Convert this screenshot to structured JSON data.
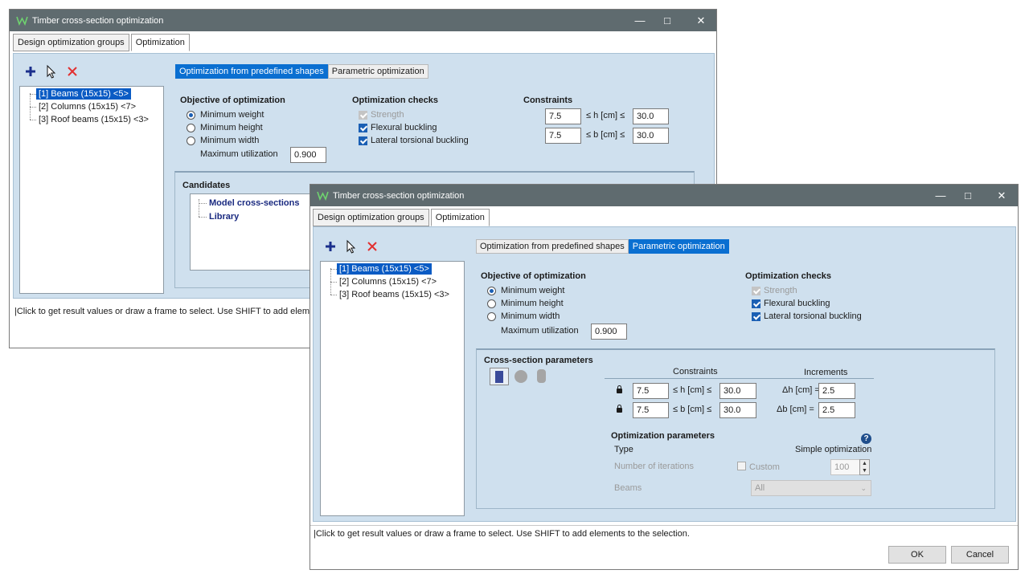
{
  "colors": {
    "titlebar": "#5f6b6f",
    "panel": "#cfe0ee",
    "accent": "#0a6fd1",
    "selection": "#0a5bc4"
  },
  "back_window": {
    "title": "Timber cross-section optimization",
    "tabs": [
      "Design optimization groups",
      "Optimization"
    ],
    "toolbar_icons": [
      "plus-icon",
      "pointer-icon",
      "close-red-icon"
    ],
    "groups": [
      "[1] Beams (15x15) <5>",
      "[2] Columns (15x15) <7>",
      "[3] Roof beams (15x15) <3>"
    ],
    "mode_buttons": {
      "predefined": "Optimization from predefined shapes",
      "parametric": "Parametric optimization"
    },
    "objective": {
      "header": "Objective of optimization",
      "options": [
        "Minimum weight",
        "Minimum height",
        "Minimum width"
      ],
      "selected": 0,
      "max_util_label": "Maximum utilization",
      "max_util_value": "0.900"
    },
    "checks": {
      "header": "Optimization checks",
      "items": [
        "Strength",
        "Flexural buckling",
        "Lateral torsional buckling"
      ]
    },
    "constraints": {
      "header": "Constraints",
      "h_min": "7.5",
      "h_label": "≤ h [cm] ≤",
      "h_max": "30.0",
      "b_min": "7.5",
      "b_label": "≤ b [cm] ≤",
      "b_max": "30.0"
    },
    "candidates": {
      "header": "Candidates",
      "items": [
        "Model cross-sections",
        "Library"
      ]
    },
    "status": "|Click to get result values or draw a frame to select. Use SHIFT to add elements"
  },
  "front_window": {
    "title": "Timber cross-section optimization",
    "tabs": [
      "Design optimization groups",
      "Optimization"
    ],
    "toolbar_icons": [
      "plus-icon",
      "pointer-icon",
      "close-red-icon"
    ],
    "groups": [
      "[1] Beams (15x15) <5>",
      "[2] Columns (15x15) <7>",
      "[3] Roof beams (15x15) <3>"
    ],
    "mode_buttons": {
      "predefined": "Optimization from predefined shapes",
      "parametric": "Parametric optimization"
    },
    "objective": {
      "header": "Objective of optimization",
      "options": [
        "Minimum weight",
        "Minimum height",
        "Minimum width"
      ],
      "selected": 0,
      "max_util_label": "Maximum utilization",
      "max_util_value": "0.900"
    },
    "checks": {
      "header": "Optimization checks",
      "items": [
        "Strength",
        "Flexural buckling",
        "Lateral torsional buckling"
      ]
    },
    "cs_params": {
      "header": "Cross-section parameters",
      "shape_icons": [
        "rectangle-shape-icon",
        "circle-shape-icon",
        "rounded-shape-icon"
      ],
      "constraints_header": "Constraints",
      "increments_header": "Increments",
      "h_min": "7.5",
      "h_label": "≤ h [cm] ≤",
      "h_max": "30.0",
      "dh_label": "Δh [cm] =",
      "dh_value": "2.5",
      "b_min": "7.5",
      "b_label": "≤ b [cm] ≤",
      "b_max": "30.0",
      "db_label": "Δb [cm] =",
      "db_value": "2.5"
    },
    "opt_params": {
      "header": "Optimization parameters",
      "type_label": "Type",
      "type_value": "Simple optimization",
      "iterations_label": "Number of iterations",
      "custom_label": "Custom",
      "iterations_value": "100",
      "beams_label": "Beams",
      "beams_value": "All"
    },
    "status": "|Click to get result values or draw a frame to select. Use SHIFT to add elements to the selection.",
    "ok": "OK",
    "cancel": "Cancel"
  }
}
